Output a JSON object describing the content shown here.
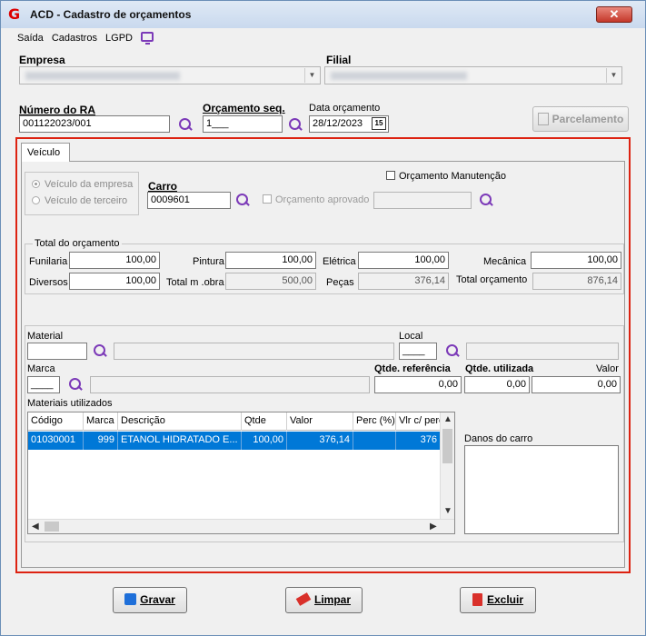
{
  "window": {
    "title": "ACD - Cadastro de orçamentos",
    "close_glyph": "✕"
  },
  "menu": [
    "Saída",
    "Cadastros",
    "LGPD"
  ],
  "header": {
    "empresa_label": "Empresa",
    "filial_label": "Filial",
    "numero_ra_label": "Número do RA",
    "numero_ra_value": "001122023/001",
    "orcamento_seq_label": "Orçamento seq.",
    "orcamento_seq_value": "1___",
    "data_orcamento_label": "Data orçamento",
    "data_orcamento_value": "28/12/2023",
    "calendar_glyph": "15",
    "parcelamento_label": "Parcelamento"
  },
  "tab": {
    "label": "Veículo"
  },
  "veiculo": {
    "radio_empresa": "Veículo da empresa",
    "radio_terceiro": "Veículo de terceiro",
    "carro_label": "Carro",
    "carro_value": "0009601",
    "orcamento_manutencao": "Orçamento Manutenção",
    "orcamento_aprovado": "Orçamento aprovado"
  },
  "totais": {
    "title": "Total do orçamento",
    "funilaria_label": "Funilaria",
    "funilaria_value": "100,00",
    "pintura_label": "Pintura",
    "pintura_value": "100,00",
    "eletrica_label": "Elétrica",
    "eletrica_value": "100,00",
    "mecanica_label": "Mecânica",
    "mecanica_value": "100,00",
    "diversos_label": "Diversos",
    "diversos_value": "100,00",
    "total_mobra_label": "Total m .obra",
    "total_mobra_value": "500,00",
    "pecas_label": "Peças",
    "pecas_value": "376,14",
    "total_orcamento_label": "Total orçamento",
    "total_orcamento_value": "876,14"
  },
  "material": {
    "material_label": "Material",
    "local_label": "Local",
    "local_value": "____",
    "marca_label": "Marca",
    "marca_value": "____",
    "qtde_referencia_label": "Qtde. referência",
    "qtde_referencia_value": "0,00",
    "qtde_utilizada_label": "Qtde. utilizada",
    "qtde_utilizada_value": "0,00",
    "valor_label": "Valor",
    "valor_value": "0,00",
    "materiais_utilizados_label": "Materiais utilizados",
    "danos_label": "Danos do carro"
  },
  "grid": {
    "columns": [
      "Código",
      "Marca",
      "Descrição",
      "Qtde",
      "Valor",
      "Perc (%)",
      "Vlr c/ perc"
    ],
    "rows": [
      [
        "01030001",
        "999",
        "ETANOL HIDRATADO E...",
        "100,00",
        "376,14",
        "",
        "376"
      ]
    ]
  },
  "footer": {
    "gravar": "Gravar",
    "limpar": "Limpar",
    "excluir": "Excluir"
  },
  "colors": {
    "accent_purple": "#7c3ab8",
    "highlight_frame": "#dd2211",
    "selection": "#0078d7"
  }
}
